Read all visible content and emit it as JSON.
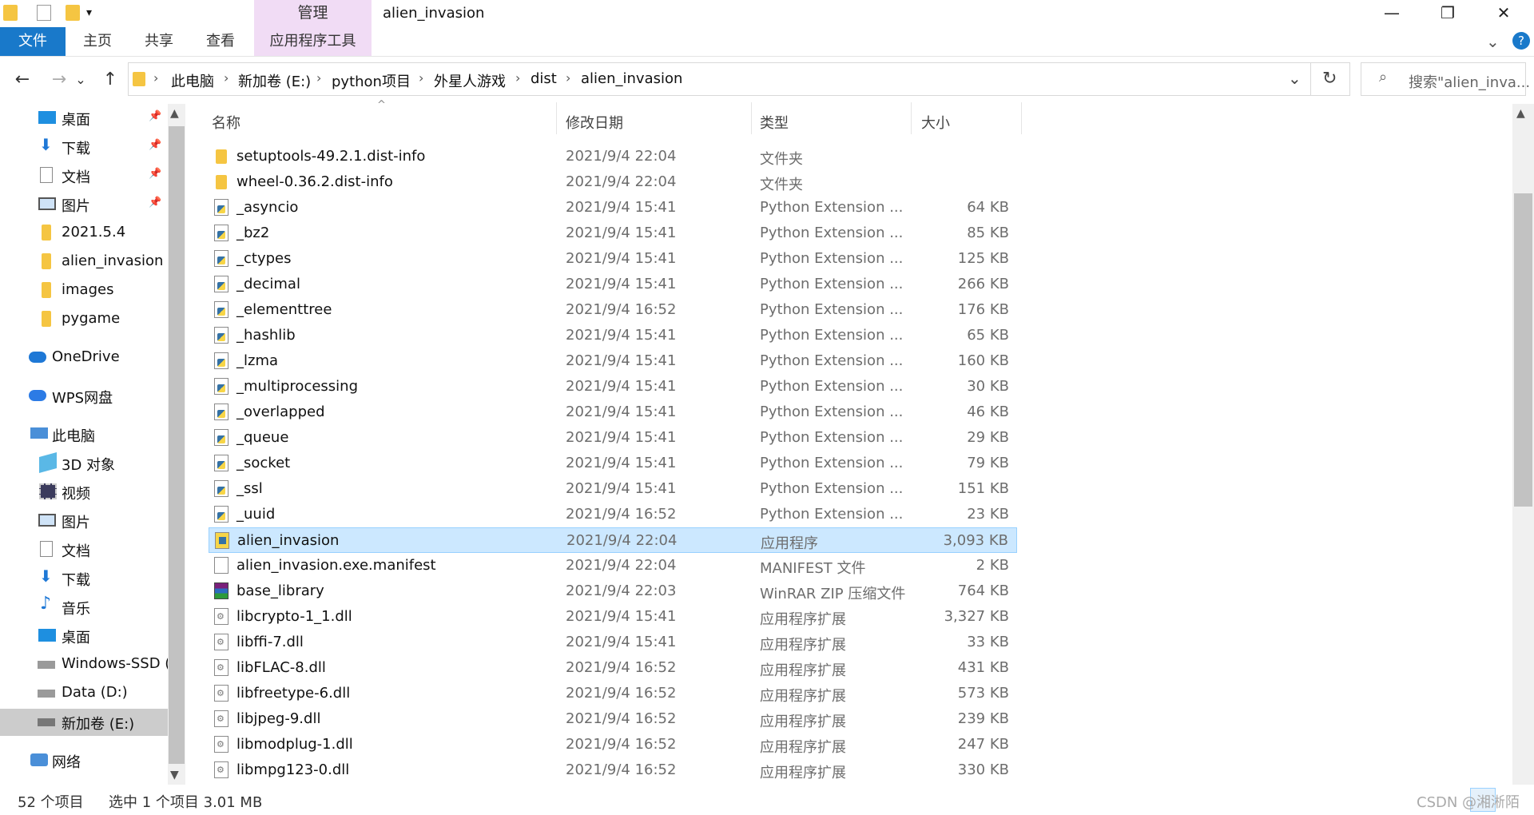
{
  "window": {
    "title": "alien_invasion",
    "manage_label": "管理",
    "minimize": "—",
    "maximize": "❐",
    "close": "✕"
  },
  "ribbon": {
    "tabs": [
      "文件",
      "主页",
      "共享",
      "查看",
      "应用程序工具"
    ],
    "help": "?",
    "collapse": "⌄"
  },
  "nav": {
    "back": "←",
    "forward": "→",
    "recent": "⌄",
    "up": "↑"
  },
  "address": {
    "segments": [
      "此电脑",
      "新加卷 (E:)",
      "python项目",
      "外星人游戏",
      "dist",
      "alien_invasion"
    ],
    "separator": "›",
    "dropdown": "⌄",
    "refresh": "↻"
  },
  "search": {
    "placeholder": "搜索\"alien_inva..."
  },
  "sidebar": {
    "items": [
      {
        "label": "桌面",
        "icon": "desktop-icon",
        "pinned": true
      },
      {
        "label": "下载",
        "icon": "download-icon",
        "pinned": true
      },
      {
        "label": "文档",
        "icon": "document-icon",
        "pinned": true
      },
      {
        "label": "图片",
        "icon": "pictures-icon",
        "pinned": true
      },
      {
        "label": "2021.5.4",
        "icon": "folder-icon",
        "pinned": false
      },
      {
        "label": "alien_invasion",
        "icon": "folder-icon",
        "pinned": false
      },
      {
        "label": "images",
        "icon": "folder-icon",
        "pinned": false
      },
      {
        "label": "pygame",
        "icon": "folder-icon",
        "pinned": false
      },
      {
        "label": "OneDrive",
        "icon": "cloud-icon",
        "pinned": false
      },
      {
        "label": "WPS网盘",
        "icon": "cloud-icon",
        "pinned": false
      },
      {
        "label": "此电脑",
        "icon": "computer-icon",
        "pinned": false
      },
      {
        "label": "3D 对象",
        "icon": "3d-objects-icon",
        "pinned": false
      },
      {
        "label": "视频",
        "icon": "video-icon",
        "pinned": false
      },
      {
        "label": "图片",
        "icon": "pictures-icon",
        "pinned": false
      },
      {
        "label": "文档",
        "icon": "document-icon",
        "pinned": false
      },
      {
        "label": "下载",
        "icon": "download-icon",
        "pinned": false
      },
      {
        "label": "音乐",
        "icon": "music-icon",
        "pinned": false
      },
      {
        "label": "桌面",
        "icon": "desktop-icon",
        "pinned": false
      },
      {
        "label": "Windows-SSD (",
        "icon": "drive-icon",
        "pinned": false
      },
      {
        "label": "Data (D:)",
        "icon": "drive-icon",
        "pinned": false
      },
      {
        "label": "新加卷 (E:)",
        "icon": "drive-icon",
        "pinned": false
      },
      {
        "label": "网络",
        "icon": "network-icon",
        "pinned": false
      }
    ]
  },
  "columns": {
    "name": "名称",
    "date": "修改日期",
    "type": "类型",
    "size": "大小",
    "sort_indicator": "^"
  },
  "files": [
    {
      "name": "setuptools-49.2.1.dist-info",
      "date": "2021/9/4 22:04",
      "type": "文件夹",
      "size": "",
      "icon": "folder"
    },
    {
      "name": "wheel-0.36.2.dist-info",
      "date": "2021/9/4 22:04",
      "type": "文件夹",
      "size": "",
      "icon": "folder"
    },
    {
      "name": "_asyncio",
      "date": "2021/9/4 15:41",
      "type": "Python Extension ...",
      "size": "64 KB",
      "icon": "pyd"
    },
    {
      "name": "_bz2",
      "date": "2021/9/4 15:41",
      "type": "Python Extension ...",
      "size": "85 KB",
      "icon": "pyd"
    },
    {
      "name": "_ctypes",
      "date": "2021/9/4 15:41",
      "type": "Python Extension ...",
      "size": "125 KB",
      "icon": "pyd"
    },
    {
      "name": "_decimal",
      "date": "2021/9/4 15:41",
      "type": "Python Extension ...",
      "size": "266 KB",
      "icon": "pyd"
    },
    {
      "name": "_elementtree",
      "date": "2021/9/4 16:52",
      "type": "Python Extension ...",
      "size": "176 KB",
      "icon": "pyd"
    },
    {
      "name": "_hashlib",
      "date": "2021/9/4 15:41",
      "type": "Python Extension ...",
      "size": "65 KB",
      "icon": "pyd"
    },
    {
      "name": "_lzma",
      "date": "2021/9/4 15:41",
      "type": "Python Extension ...",
      "size": "160 KB",
      "icon": "pyd"
    },
    {
      "name": "_multiprocessing",
      "date": "2021/9/4 15:41",
      "type": "Python Extension ...",
      "size": "30 KB",
      "icon": "pyd"
    },
    {
      "name": "_overlapped",
      "date": "2021/9/4 15:41",
      "type": "Python Extension ...",
      "size": "46 KB",
      "icon": "pyd"
    },
    {
      "name": "_queue",
      "date": "2021/9/4 15:41",
      "type": "Python Extension ...",
      "size": "29 KB",
      "icon": "pyd"
    },
    {
      "name": "_socket",
      "date": "2021/9/4 15:41",
      "type": "Python Extension ...",
      "size": "79 KB",
      "icon": "pyd"
    },
    {
      "name": "_ssl",
      "date": "2021/9/4 15:41",
      "type": "Python Extension ...",
      "size": "151 KB",
      "icon": "pyd"
    },
    {
      "name": "_uuid",
      "date": "2021/9/4 16:52",
      "type": "Python Extension ...",
      "size": "23 KB",
      "icon": "pyd"
    },
    {
      "name": "alien_invasion",
      "date": "2021/9/4 22:04",
      "type": "应用程序",
      "size": "3,093 KB",
      "icon": "exe",
      "selected": true
    },
    {
      "name": "alien_invasion.exe.manifest",
      "date": "2021/9/4 22:04",
      "type": "MANIFEST 文件",
      "size": "2 KB",
      "icon": "file"
    },
    {
      "name": "base_library",
      "date": "2021/9/4 22:03",
      "type": "WinRAR ZIP 压缩文件",
      "size": "764 KB",
      "icon": "zip"
    },
    {
      "name": "libcrypto-1_1.dll",
      "date": "2021/9/4 15:41",
      "type": "应用程序扩展",
      "size": "3,327 KB",
      "icon": "dll"
    },
    {
      "name": "libffi-7.dll",
      "date": "2021/9/4 15:41",
      "type": "应用程序扩展",
      "size": "33 KB",
      "icon": "dll"
    },
    {
      "name": "libFLAC-8.dll",
      "date": "2021/9/4 16:52",
      "type": "应用程序扩展",
      "size": "431 KB",
      "icon": "dll"
    },
    {
      "name": "libfreetype-6.dll",
      "date": "2021/9/4 16:52",
      "type": "应用程序扩展",
      "size": "573 KB",
      "icon": "dll"
    },
    {
      "name": "libjpeg-9.dll",
      "date": "2021/9/4 16:52",
      "type": "应用程序扩展",
      "size": "239 KB",
      "icon": "dll"
    },
    {
      "name": "libmodplug-1.dll",
      "date": "2021/9/4 16:52",
      "type": "应用程序扩展",
      "size": "247 KB",
      "icon": "dll"
    },
    {
      "name": "libmpg123-0.dll",
      "date": "2021/9/4 16:52",
      "type": "应用程序扩展",
      "size": "330 KB",
      "icon": "dll"
    }
  ],
  "status": {
    "count": "52 个项目",
    "selection": "选中 1 个项目  3.01 MB"
  },
  "watermark": "CSDN @湘淅陌"
}
